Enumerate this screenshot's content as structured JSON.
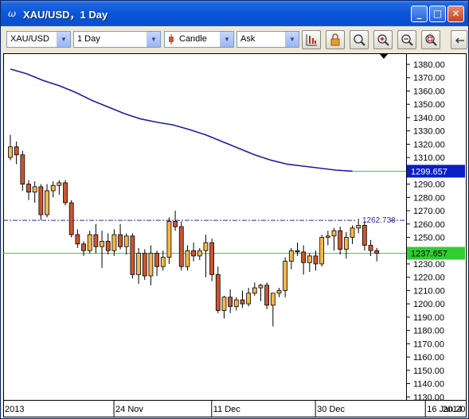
{
  "window": {
    "title": "XAU/USD，1 Day",
    "icon": "chart-app-icon",
    "controls": [
      "minimize-icon",
      "maximize-icon",
      "close-icon"
    ]
  },
  "toolbar": {
    "symbol": "XAU/USD",
    "period": "1 Day",
    "chart_type": "Candle",
    "price_side": "Ask",
    "icons": [
      "chart-properties-icon",
      "lock-icon",
      "zoom-icon",
      "zoom-in-icon",
      "zoom-out-icon",
      "fit-zoom-icon",
      "more-icon"
    ]
  },
  "colors": {
    "bull_candle": "#f5b84a",
    "bear_candle": "#cc5530",
    "moving_average": "#1c1ca8",
    "current_price_line": "#33cc33",
    "max_label_bg": "#0a1ec8",
    "price_label_bg": "#33cc33",
    "reference_line": "#2a2ab0"
  },
  "chart_data": {
    "type": "candlestick",
    "ylim": [
      1125,
      1390
    ],
    "y_ticks": [
      1380,
      1370,
      1360,
      1350,
      1340,
      1330,
      1320,
      1310,
      1300,
      1290,
      1280,
      1270,
      1260,
      1250,
      1240,
      1230,
      1220,
      1210,
      1200,
      1190,
      1180,
      1170,
      1160,
      1150,
      1140,
      1130
    ],
    "y_tick_labels": [
      "1380.00",
      "1370.00",
      "1360.00",
      "1350.00",
      "1340.00",
      "1330.00",
      "1320.00",
      "1310.00",
      "1300.00",
      "1290.00",
      "1280.00",
      "1270.00",
      "1260.00",
      "1250.00",
      "1240.00",
      "1230.00",
      "1220.00",
      "1210.00",
      "1200.00",
      "1190.00",
      "1180.00",
      "1170.00",
      "1160.00",
      "1150.00",
      "1140.00",
      "1130.00"
    ],
    "x_labels": [
      "2013",
      "24 Nov",
      "11 Dec",
      "30 Dec",
      "16 Jan 2014",
      "2014"
    ],
    "x_label_index": [
      0,
      18,
      34,
      51,
      69,
      78
    ],
    "candles": [
      [
        1310,
        1327,
        1308,
        1318
      ],
      [
        1318,
        1322,
        1305,
        1312
      ],
      [
        1312,
        1315,
        1285,
        1290
      ],
      [
        1290,
        1293,
        1278,
        1284
      ],
      [
        1284,
        1292,
        1276,
        1288
      ],
      [
        1288,
        1290,
        1263,
        1267
      ],
      [
        1267,
        1290,
        1265,
        1285
      ],
      [
        1285,
        1292,
        1280,
        1289
      ],
      [
        1289,
        1293,
        1282,
        1291
      ],
      [
        1291,
        1293,
        1274,
        1276
      ],
      [
        1276,
        1278,
        1250,
        1252
      ],
      [
        1252,
        1256,
        1242,
        1245
      ],
      [
        1245,
        1247,
        1236,
        1240
      ],
      [
        1240,
        1255,
        1238,
        1252
      ],
      [
        1252,
        1260,
        1238,
        1243
      ],
      [
        1243,
        1255,
        1227,
        1247
      ],
      [
        1247,
        1253,
        1237,
        1240
      ],
      [
        1240,
        1256,
        1236,
        1252
      ],
      [
        1252,
        1260,
        1241,
        1243
      ],
      [
        1243,
        1253,
        1237,
        1251
      ],
      [
        1251,
        1253,
        1219,
        1222
      ],
      [
        1222,
        1242,
        1215,
        1238
      ],
      [
        1238,
        1241,
        1218,
        1221
      ],
      [
        1221,
        1244,
        1214,
        1238
      ],
      [
        1238,
        1240,
        1221,
        1228
      ],
      [
        1228,
        1240,
        1225,
        1235
      ],
      [
        1235,
        1265,
        1230,
        1262
      ],
      [
        1262,
        1270,
        1255,
        1258
      ],
      [
        1258,
        1262,
        1225,
        1228
      ],
      [
        1228,
        1244,
        1225,
        1240
      ],
      [
        1240,
        1246,
        1232,
        1236
      ],
      [
        1236,
        1242,
        1233,
        1240
      ],
      [
        1240,
        1252,
        1220,
        1246
      ],
      [
        1246,
        1249,
        1217,
        1222
      ],
      [
        1222,
        1228,
        1193,
        1195
      ],
      [
        1195,
        1206,
        1189,
        1205
      ],
      [
        1205,
        1211,
        1193,
        1198
      ],
      [
        1198,
        1205,
        1195,
        1203
      ],
      [
        1203,
        1210,
        1197,
        1200
      ],
      [
        1200,
        1212,
        1198,
        1208
      ],
      [
        1208,
        1216,
        1206,
        1212
      ],
      [
        1212,
        1215,
        1202,
        1214
      ],
      [
        1214,
        1216,
        1196,
        1199
      ],
      [
        1199,
        1205,
        1183,
        1208
      ],
      [
        1208,
        1212,
        1205,
        1210
      ],
      [
        1210,
        1235,
        1205,
        1232
      ],
      [
        1232,
        1242,
        1226,
        1240
      ],
      [
        1240,
        1246,
        1236,
        1239
      ],
      [
        1239,
        1244,
        1222,
        1231
      ],
      [
        1231,
        1238,
        1224,
        1236
      ],
      [
        1236,
        1240,
        1225,
        1230
      ],
      [
        1230,
        1252,
        1228,
        1250
      ],
      [
        1250,
        1255,
        1244,
        1251
      ],
      [
        1251,
        1257,
        1240,
        1255
      ],
      [
        1255,
        1258,
        1237,
        1241
      ],
      [
        1241,
        1254,
        1234,
        1250
      ],
      [
        1250,
        1259,
        1245,
        1257
      ],
      [
        1257,
        1264,
        1253,
        1259
      ],
      [
        1259,
        1262,
        1240,
        1244
      ],
      [
        1244,
        1248,
        1236,
        1240
      ],
      [
        1240,
        1242,
        1232,
        1238
      ]
    ],
    "moving_average": [
      [
        0,
        1376.5
      ],
      [
        4,
        1373
      ],
      [
        8,
        1368
      ],
      [
        12,
        1364
      ],
      [
        16,
        1359
      ],
      [
        20,
        1353
      ],
      [
        24,
        1348
      ],
      [
        28,
        1343
      ],
      [
        32,
        1339
      ],
      [
        36,
        1336.5
      ],
      [
        40,
        1334.5
      ],
      [
        44,
        1331
      ],
      [
        48,
        1327
      ],
      [
        52,
        1322
      ],
      [
        56,
        1317
      ],
      [
        60,
        1312
      ],
      [
        64,
        1308
      ],
      [
        68,
        1305
      ],
      [
        72,
        1303.5
      ],
      [
        76,
        1302
      ],
      [
        80,
        1300.5
      ],
      [
        84,
        1299.7
      ]
    ],
    "max_price_label": "1299.657",
    "current_price_label": "1237.657",
    "reference_level": 1262.738,
    "reference_label": "1262.738"
  }
}
